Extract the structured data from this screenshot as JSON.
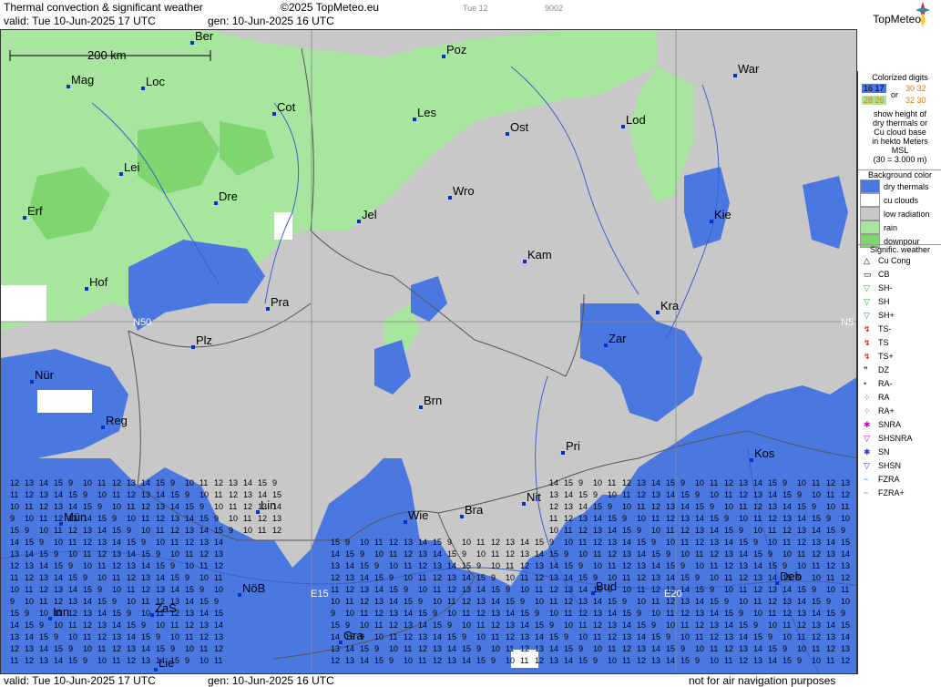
{
  "header": {
    "title": "Thermal convection & significant weather",
    "copyright": "©2025 TopMeteo.eu",
    "tab": "Tue 12",
    "code": "9002",
    "valid": "valid:  Tue  10-Jun-2025  17 UTC",
    "gen": "gen: 10-Jun-2025 16 UTC",
    "logo": "TopMeteo"
  },
  "footer": {
    "valid": "valid:  Tue  10-Jun-2025  17 UTC",
    "gen": "gen: 10-Jun-2025 16 UTC",
    "disclaimer": "not for air navigation purposes"
  },
  "map": {
    "scale": "200 km",
    "grid_labels": [
      "N50",
      "N5",
      "E15",
      "E20"
    ],
    "cities": [
      "Ber",
      "Poz",
      "War",
      "Mag",
      "Loc",
      "Cot",
      "Les",
      "Lod",
      "Ost",
      "Lei",
      "Dre",
      "Wro",
      "Erf",
      "Jel",
      "Kie",
      "Kam",
      "Hof",
      "Pra",
      "Kra",
      "Zar",
      "Plz",
      "Nür",
      "Brn",
      "Reg",
      "Pri",
      "Kos",
      "Lin",
      "Nit",
      "Mün",
      "Wie",
      "Bra",
      "Deb",
      "NöB",
      "Bud",
      "Inn",
      "ZaS",
      "Lie",
      "Gra"
    ],
    "colors": {
      "dry": "#4a78e0",
      "low": "#c8c8c8",
      "rain": "#a8e6a0",
      "downpour": "#7fd66f",
      "cu": "#ffffff"
    }
  },
  "legend": {
    "digits_title": "Colorized digits",
    "digits_samples": [
      "16 17",
      "30 32",
      "28 26",
      "32 30"
    ],
    "digits_or": "or",
    "digits_desc": [
      "show height of",
      "dry thermals or",
      "Cu cloud base",
      "in hekto Meters",
      "MSL",
      "(30 = 3.000 m)"
    ],
    "bg_title": "Background color",
    "bg_items": [
      "dry thermals",
      "cu clouds",
      "low radiation",
      "rain",
      "downpour"
    ],
    "sw_title": "Signific. weather",
    "sw_items": [
      "Cu Cong",
      "CB",
      "SH-",
      "SH",
      "SH+",
      "TS-",
      "TS",
      "TS+",
      "DZ",
      "RA-",
      "RA",
      "RA+",
      "SNRA",
      "SHSNRA",
      "SN",
      "SHSN",
      "FZRA",
      "FZRA+"
    ]
  }
}
